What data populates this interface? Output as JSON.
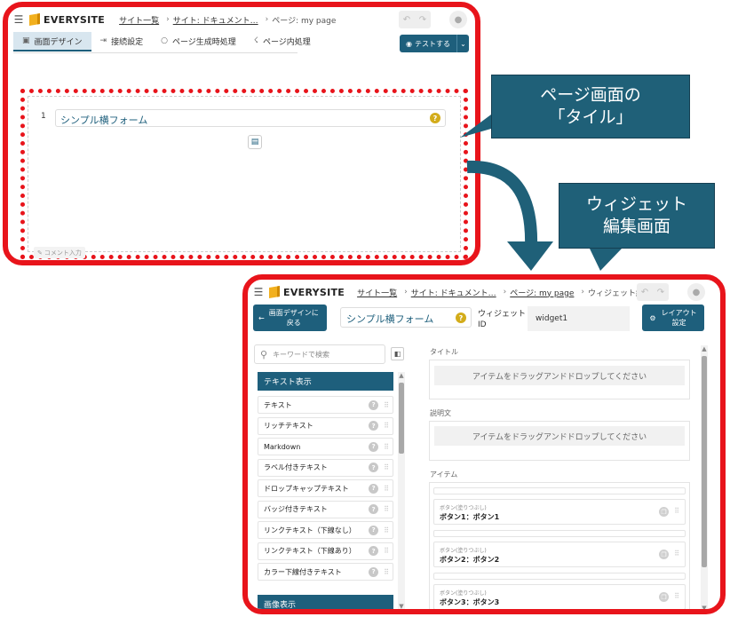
{
  "colors": {
    "frame_red": "#e8141b",
    "accent": "#1e5f7c",
    "callout_bg": "#1f6078",
    "help_yellow": "#d3ac1a"
  },
  "panel1": {
    "app_name": "EVERYSITE",
    "breadcrumbs": [
      "サイト一覧",
      "サイト: ドキュメント…",
      "ページ: my page"
    ],
    "tabs": [
      {
        "icon": "image-icon",
        "label": "画面デザイン"
      },
      {
        "icon": "link-icon",
        "label": "接続設定"
      },
      {
        "icon": "circle-icon",
        "label": "ページ生成時処理"
      },
      {
        "icon": "run-icon",
        "label": "ページ内処理"
      }
    ],
    "test_button": "テストする",
    "tile": {
      "row_number": "1",
      "title": "シンプル横フォーム",
      "comment_label": "コメント入力"
    }
  },
  "callouts": {
    "tile": [
      "ページ画面の",
      "「タイル」"
    ],
    "widget": [
      "ウィジェット",
      "編集画面"
    ]
  },
  "panel2": {
    "app_name": "EVERYSITE",
    "breadcrumbs": [
      "サイト一覧",
      "サイト: ドキュメント…",
      "ページ: my page"
    ],
    "breadcrumb_current": "ウィジェット編集",
    "back_button": [
      "画面デザインに",
      "戻る"
    ],
    "widget_title": "シンプル横フォーム",
    "widget_id_label": [
      "ウィジェット",
      "ID"
    ],
    "widget_id_value": "widget1",
    "layout_button": [
      "レイアウト",
      "設定"
    ],
    "search_placeholder": "キーワードで検索",
    "categories": [
      {
        "name": "テキスト表示",
        "items": [
          "テキスト",
          "リッチテキスト",
          "Markdown",
          "ラベル付きテキスト",
          "ドロップキャップテキスト",
          "バッジ付きテキスト",
          "リンクテキスト（下線なし）",
          "リンクテキスト（下線あり）",
          "カラー下線付きテキスト"
        ]
      },
      {
        "name": "画像表示",
        "items": []
      }
    ],
    "sections": {
      "title_label": "タイトル",
      "desc_label": "説明文",
      "items_label": "アイテム",
      "dropzone_text": "アイテムをドラッグアンドドロップしてください"
    },
    "items": [
      {
        "type": "ボタン(塗りつぶし)",
        "name": "ボタン1：ボタン1"
      },
      {
        "type": "ボタン(塗りつぶし)",
        "name": "ボタン2：ボタン2"
      },
      {
        "type": "ボタン(塗りつぶし)",
        "name": "ボタン3：ボタン3"
      }
    ]
  }
}
